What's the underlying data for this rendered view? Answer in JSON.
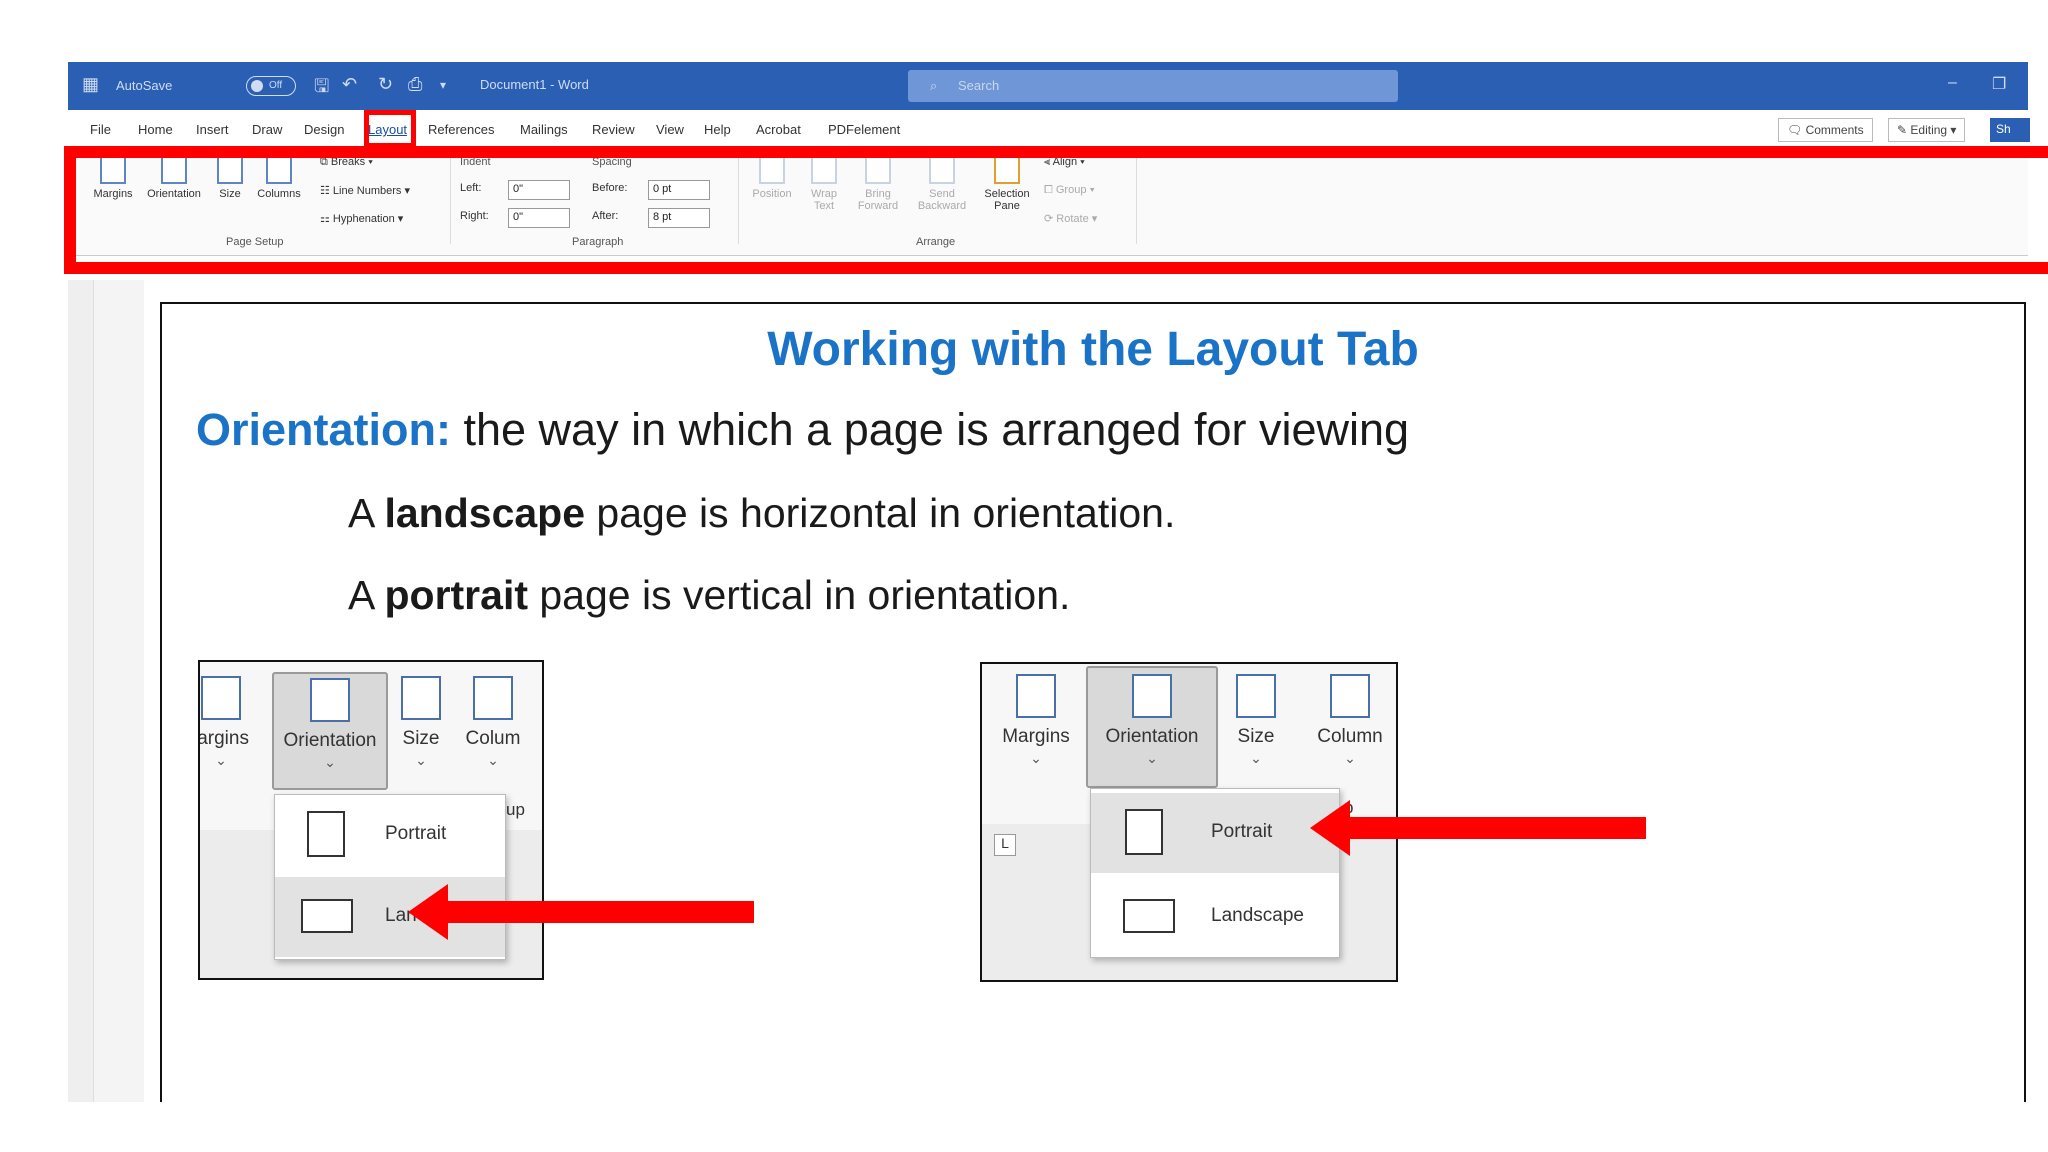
{
  "colors": {
    "title_bar": "#2b5fb4",
    "accent_blue": "#1a73c6",
    "highlight_red": "#ff0000"
  },
  "titlebar": {
    "autosave_label": "AutoSave",
    "autosave_state": "Off",
    "doc_title": "Document1 - Word",
    "search_placeholder": "Search"
  },
  "menu": {
    "items": [
      "File",
      "Home",
      "Insert",
      "Draw",
      "Design",
      "Layout",
      "References",
      "Mailings",
      "Review",
      "View",
      "Help",
      "Acrobat",
      "PDFelement"
    ],
    "comments": "Comments",
    "editing": "Editing",
    "share": "Sh"
  },
  "ribbon": {
    "page_setup": {
      "margins": "Margins",
      "orientation": "Orientation",
      "size": "Size",
      "columns": "Columns",
      "breaks": "Breaks",
      "line_numbers": "Line Numbers",
      "hyphenation": "Hyphenation",
      "group_label": "Page Setup"
    },
    "paragraph": {
      "indent": "Indent",
      "spacing": "Spacing",
      "left": "Left:",
      "right": "Right:",
      "before": "Before:",
      "after": "After:",
      "left_value": "0\"",
      "right_value": "0\"",
      "before_value": "0 pt",
      "after_value": "8 pt",
      "group_label": "Paragraph"
    },
    "arrange": {
      "position": "Position",
      "wrap_text": "Wrap Text",
      "bring_forward": "Bring Forward",
      "send_backward": "Send Backward",
      "selection_pane": "Selection Pane",
      "align": "Align",
      "group": "Group",
      "rotate": "Rotate",
      "group_label": "Arrange"
    }
  },
  "slide": {
    "title": "Working with the Layout Tab",
    "term": "Orientation:",
    "definition": " the way in which a page is arranged for viewing",
    "line1_a": "A ",
    "line1_bold": "landscape",
    "line1_b": " page is horizontal in orientation.",
    "line2_a": "A ",
    "line2_bold": "portrait",
    "line2_b": " page is vertical in orientation."
  },
  "inset_left": {
    "margins": "largins",
    "orientation": "Orientation",
    "size": "Size",
    "columns": "Colum",
    "portrait": "Portrait",
    "landscape": "Lan",
    "group_frag": "up"
  },
  "inset_right": {
    "margins": "Margins",
    "orientation": "Orientation",
    "size": "Size",
    "columns": "Column",
    "portrait": "Portrait",
    "landscape": "Landscape",
    "group_frag": "p"
  }
}
